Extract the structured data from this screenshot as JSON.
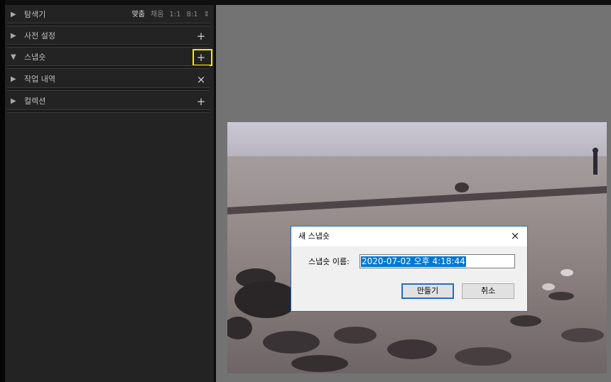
{
  "left_panel": {
    "sections": [
      {
        "label": "탐색기",
        "icon": "triangle-right"
      },
      {
        "label": "사전 설정",
        "icon": "triangle-right",
        "action": "+"
      },
      {
        "label": "스냅숏",
        "icon": "triangle-down",
        "action": "+"
      },
      {
        "label": "작업 내역",
        "icon": "triangle-right",
        "action": "×"
      },
      {
        "label": "컬렉션",
        "icon": "triangle-right",
        "action": "+"
      }
    ],
    "navigator_options": [
      "맞춤",
      "채움",
      "1:1",
      "8:1",
      "⇕"
    ]
  },
  "dialog": {
    "title": "새 스냅숏",
    "name_label": "스냅숏 이름:",
    "name_value": "2020-07-02 오후 4:18:44",
    "create_button": "만들기",
    "cancel_button": "취소",
    "close_glyph": "×"
  },
  "colors": {
    "panel_bg": "#232323",
    "canvas_bg": "#737373",
    "highlight": "#ffe600",
    "accent": "#0078d7"
  }
}
